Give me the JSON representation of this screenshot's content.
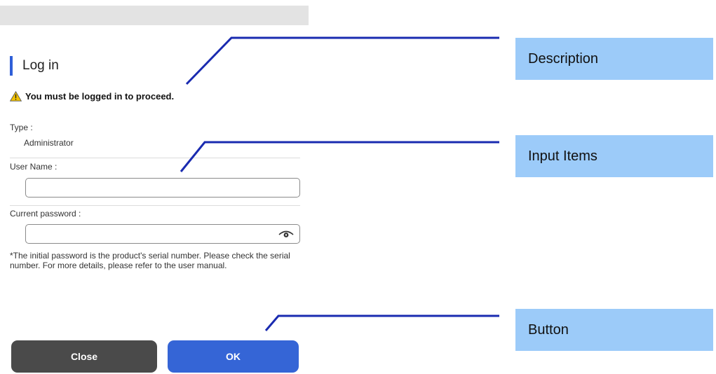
{
  "dialog": {
    "title": "Log in",
    "warning": "You must be logged in to proceed.",
    "type_label": "Type :",
    "type_value": "Administrator",
    "username_label": "User Name :",
    "username_value": "",
    "password_label": "Current password :",
    "password_value": "",
    "note": "*The initial password is the product's serial number. Please check the serial number. For more details, please refer to the user manual.",
    "close_label": "Close",
    "ok_label": "OK"
  },
  "callouts": {
    "description": "Description",
    "input_items": "Input Items",
    "button": "Button"
  },
  "colors": {
    "accent": "#2f5fd8",
    "ok_button": "#3565d6",
    "close_button": "#4a4a4a",
    "callout_bg": "#9ccbf9",
    "leader_line": "#1a2bb0",
    "warning_icon": "#f2c200"
  },
  "icons": {
    "warning": "warning-triangle-icon",
    "show_password": "eye-icon"
  }
}
